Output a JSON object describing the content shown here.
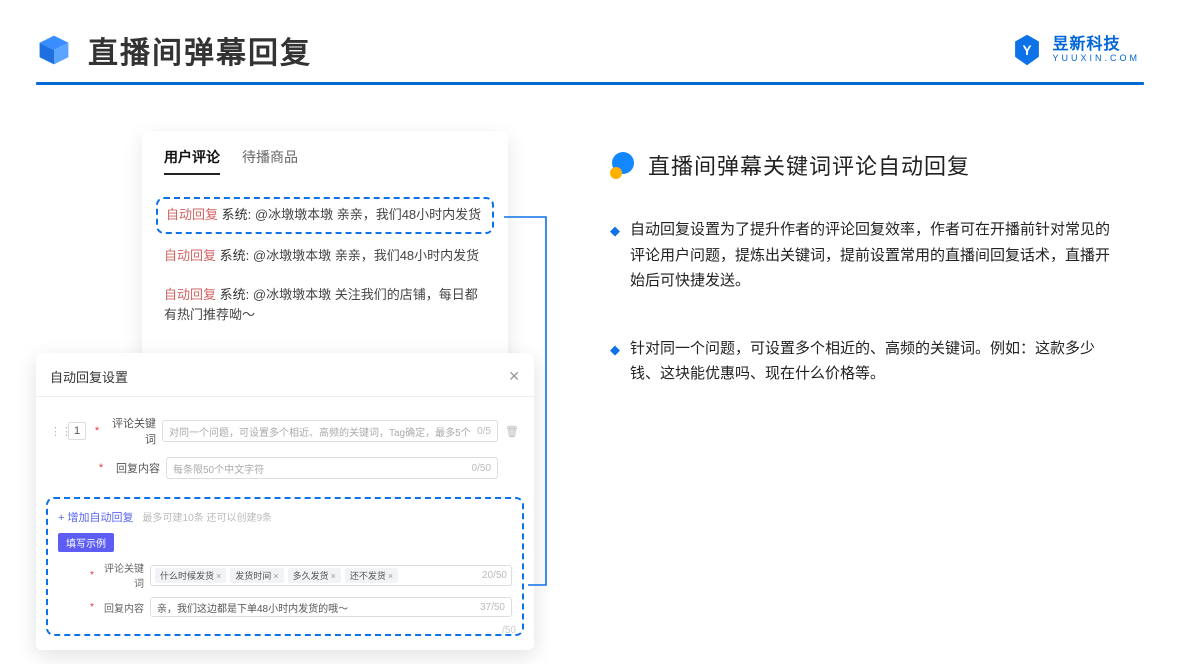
{
  "header": {
    "title": "直播间弹幕回复",
    "logo_cn": "昱新科技",
    "logo_en": "YUUXIN.COM"
  },
  "comments": {
    "tabs": {
      "active": "用户评论",
      "inactive": "待播商品"
    },
    "items": [
      {
        "badge": "自动回复",
        "sys": "系统:",
        "text": "@冰墩墩本墩 亲亲，我们48小时内发货"
      },
      {
        "badge": "自动回复",
        "sys": "系统:",
        "text": "@冰墩墩本墩 亲亲，我们48小时内发货"
      },
      {
        "badge": "自动回复",
        "sys": "系统:",
        "text": "@冰墩墩本墩 关注我们的店铺，每日都有热门推荐呦～"
      }
    ]
  },
  "settings": {
    "title": "自动回复设置",
    "close": "✕",
    "index": "1",
    "kw_label": "评论关键词",
    "kw_ph": "对同一个问题，可设置多个相近、高频的关键词，Tag确定，最多5个",
    "kw_cnt": "0/5",
    "reply_label": "回复内容",
    "reply_ph": "每条限50个中文字符",
    "reply_cnt": "0/50",
    "add_text": "+ 增加自动回复",
    "add_hint": "最多可建10条 还可以创建9条",
    "pill": "填写示例",
    "ex_kw_label": "评论关键词",
    "ex_tags": [
      "什么时候发货",
      "发货时间",
      "多久发货",
      "还不发货"
    ],
    "ex_kw_cnt": "20/50",
    "ex_reply_label": "回复内容",
    "ex_reply": "亲，我们这边都是下单48小时内发货的哦～",
    "ex_reply_cnt": "37/50",
    "faint_cnt": "/50"
  },
  "right": {
    "title": "直播间弹幕关键词评论自动回复",
    "b1": "自动回复设置为了提升作者的评论回复效率，作者可在开播前针对常见的评论用户问题，提炼出关键词，提前设置常用的直播间回复话术，直播开始后可快捷发送。",
    "b2": "针对同一个问题，可设置多个相近的、高频的关键词。例如：这款多少钱、这块能优惠吗、现在什么价格等。"
  }
}
